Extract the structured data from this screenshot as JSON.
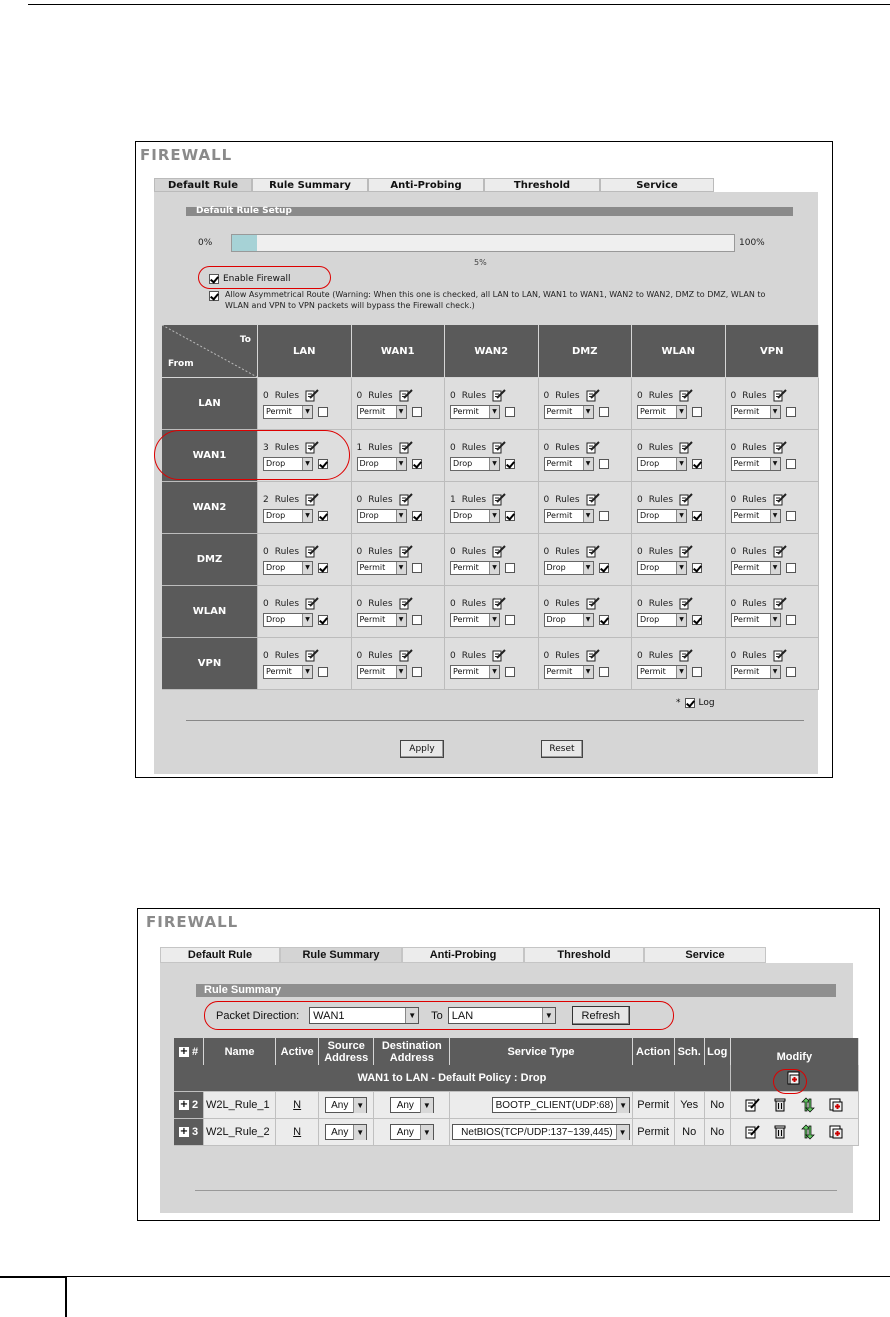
{
  "shot1": {
    "title": "FIREWALL",
    "tabs": [
      "Default Rule",
      "Rule Summary",
      "Anti-Probing",
      "Threshold",
      "Service"
    ],
    "section": "Default Rule Setup",
    "progress": {
      "left": "0%",
      "right": "100%",
      "mid": "5%",
      "value_percent": 5
    },
    "enable_firewall": {
      "label": "Enable Firewall",
      "checked": true
    },
    "asymmetrical": {
      "checked": true,
      "text": "Allow Asymmetrical Route (Warning: When this one is checked, all LAN to LAN, WAN1 to WAN1, WAN2 to WAN2, DMZ to DMZ, WLAN to WLAN and VPN to VPN packets will bypass the Firewall check.)"
    },
    "corner": {
      "to": "To",
      "from": "From"
    },
    "columns": [
      "LAN",
      "WAN1",
      "WAN2",
      "DMZ",
      "WLAN",
      "VPN"
    ],
    "rules_label": "Rules",
    "rows": [
      {
        "name": "LAN",
        "cells": [
          [
            "0",
            "Permit",
            false
          ],
          [
            "0",
            "Permit",
            false
          ],
          [
            "0",
            "Permit",
            false
          ],
          [
            "0",
            "Permit",
            false
          ],
          [
            "0",
            "Permit",
            false
          ],
          [
            "0",
            "Permit",
            false
          ]
        ]
      },
      {
        "name": "WAN1",
        "cells": [
          [
            "3",
            "Drop",
            true
          ],
          [
            "1",
            "Drop",
            true
          ],
          [
            "0",
            "Drop",
            true
          ],
          [
            "0",
            "Permit",
            false
          ],
          [
            "0",
            "Drop",
            true
          ],
          [
            "0",
            "Permit",
            false
          ]
        ]
      },
      {
        "name": "WAN2",
        "cells": [
          [
            "2",
            "Drop",
            true
          ],
          [
            "0",
            "Drop",
            true
          ],
          [
            "1",
            "Drop",
            true
          ],
          [
            "0",
            "Permit",
            false
          ],
          [
            "0",
            "Drop",
            true
          ],
          [
            "0",
            "Permit",
            false
          ]
        ]
      },
      {
        "name": "DMZ",
        "cells": [
          [
            "0",
            "Drop",
            true
          ],
          [
            "0",
            "Permit",
            false
          ],
          [
            "0",
            "Permit",
            false
          ],
          [
            "0",
            "Drop",
            true
          ],
          [
            "0",
            "Drop",
            true
          ],
          [
            "0",
            "Permit",
            false
          ]
        ]
      },
      {
        "name": "WLAN",
        "cells": [
          [
            "0",
            "Drop",
            true
          ],
          [
            "0",
            "Permit",
            false
          ],
          [
            "0",
            "Permit",
            false
          ],
          [
            "0",
            "Drop",
            true
          ],
          [
            "0",
            "Drop",
            true
          ],
          [
            "0",
            "Permit",
            false
          ]
        ]
      },
      {
        "name": "VPN",
        "cells": [
          [
            "0",
            "Permit",
            false
          ],
          [
            "0",
            "Permit",
            false
          ],
          [
            "0",
            "Permit",
            false
          ],
          [
            "0",
            "Permit",
            false
          ],
          [
            "0",
            "Permit",
            false
          ],
          [
            "0",
            "Permit",
            false
          ]
        ]
      }
    ],
    "log_label": "Log",
    "log_prefix": "*",
    "apply": "Apply",
    "reset": "Reset"
  },
  "shot2": {
    "title": "FIREWALL",
    "tabs": [
      "Default Rule",
      "Rule Summary",
      "Anti-Probing",
      "Threshold",
      "Service"
    ],
    "section": "Rule Summary",
    "packet_direction_label": "Packet Direction:",
    "from_value": "WAN1",
    "to_label": "To",
    "to_value": "LAN",
    "refresh": "Refresh",
    "headers": [
      "#",
      "Name",
      "Active",
      "Source Address",
      "Destination Address",
      "Service Type",
      "Action",
      "Sch.",
      "Log",
      "Modify"
    ],
    "default_policy": "WAN1 to LAN - Default Policy : Drop",
    "rules": [
      {
        "idx": "2",
        "name": "W2L_Rule_1",
        "active": "N",
        "src": "Any",
        "dst": "Any",
        "service": "BOOTP_CLIENT(UDP:68)",
        "action": "Permit",
        "sch": "Yes",
        "log": "No"
      },
      {
        "idx": "3",
        "name": "W2L_Rule_2",
        "active": "N",
        "src": "Any",
        "dst": "Any",
        "service": "NetBIOS(TCP/UDP:137~139,445)",
        "action": "Permit",
        "sch": "No",
        "log": "No"
      }
    ]
  },
  "colors": {
    "header": "#5a5a5a",
    "panel": "#d6d6d6",
    "highlight": "#dd0000",
    "progress": "#a6d2d6"
  }
}
